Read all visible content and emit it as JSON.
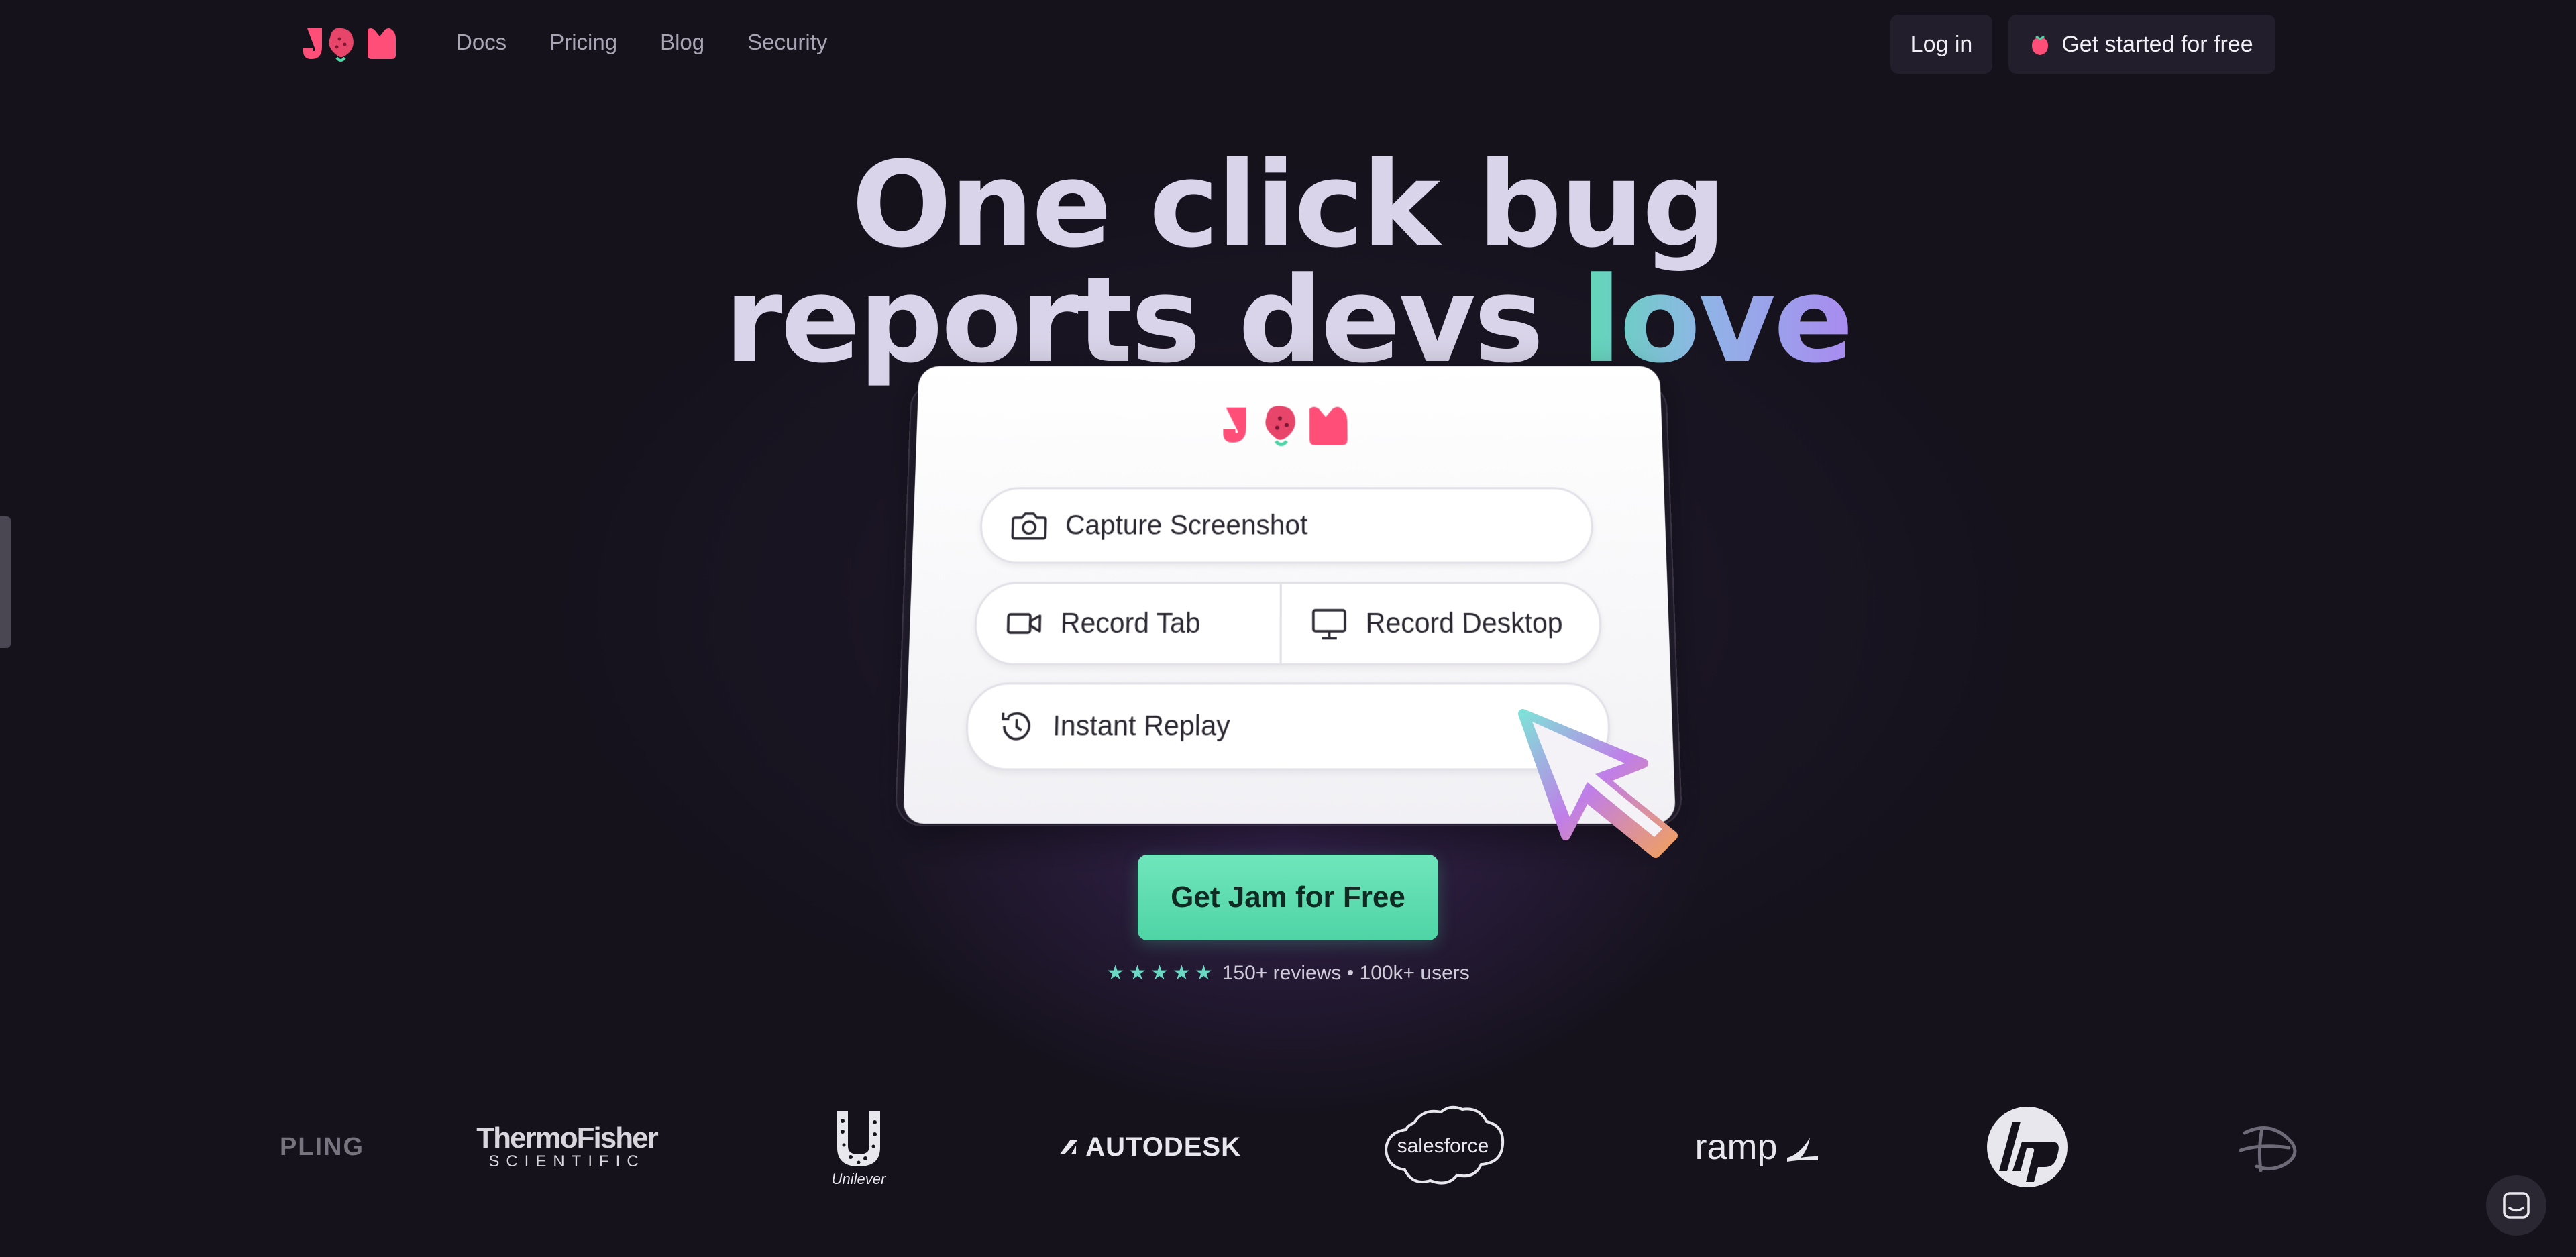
{
  "nav": {
    "brand": "JAM",
    "links": [
      {
        "label": "Docs"
      },
      {
        "label": "Pricing"
      },
      {
        "label": "Blog"
      },
      {
        "label": "Security"
      }
    ],
    "login_label": "Log in",
    "start_label": "Get started for free"
  },
  "hero": {
    "line1": "One click bug",
    "line2_a": "reports devs ",
    "line2_b": "love"
  },
  "card": {
    "capture_label": "Capture Screenshot",
    "record_tab_label": "Record Tab",
    "record_desktop_label": "Record Desktop",
    "instant_replay_label": "Instant Replay"
  },
  "cta": {
    "label": "Get Jam for Free",
    "reviews_text": "150+ reviews • 100k+ users",
    "star_count": 5
  },
  "logos": {
    "kipling": "PLING",
    "thermo_1": "ThermoFisher",
    "thermo_2": "SCIENTIFIC",
    "unilever": "Unilever",
    "autodesk": "AUTODESK",
    "salesforce": "salesforce",
    "ramp": "ramp"
  },
  "colors": {
    "background": "#15121c",
    "accent_green": "#5fd9b6",
    "accent_purple": "#a98af0",
    "brand_pink": "#e8456b"
  }
}
